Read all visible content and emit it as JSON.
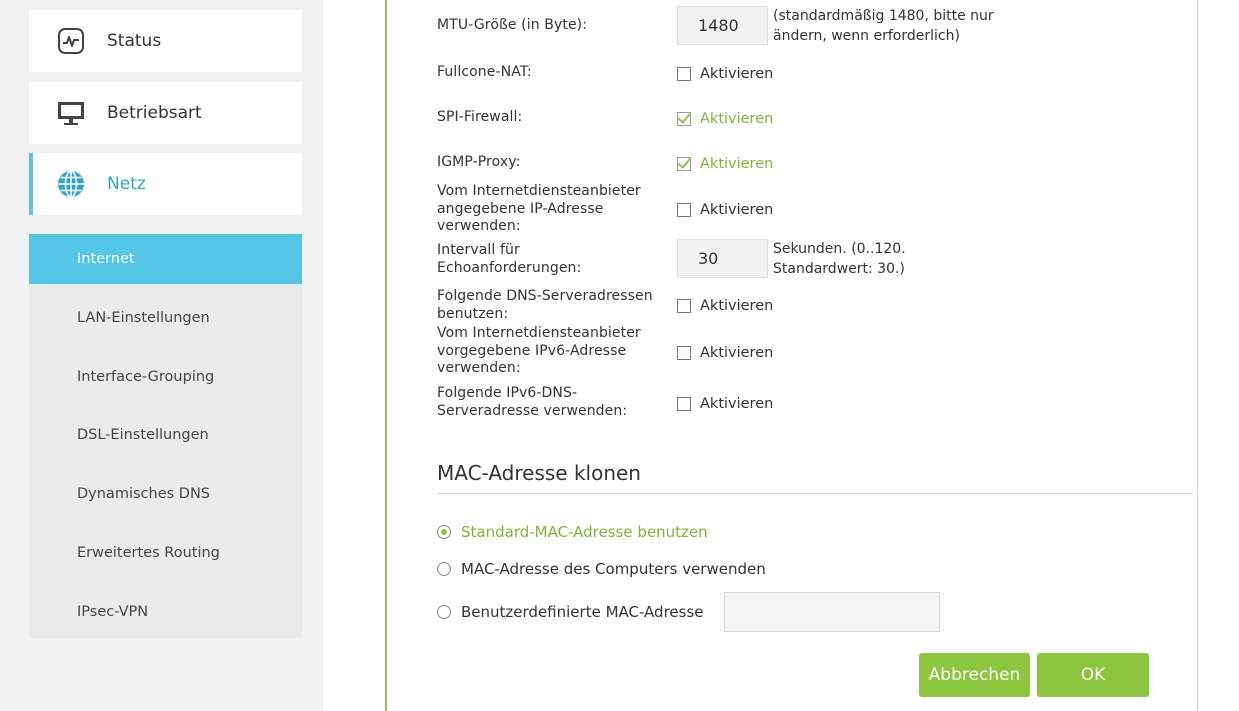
{
  "sidebar": {
    "menu": [
      {
        "label": "Status",
        "icon": "status-monitor-icon"
      },
      {
        "label": "Betriebsart",
        "icon": "monitor-icon"
      },
      {
        "label": "Netz",
        "icon": "globe-icon",
        "active": true
      }
    ],
    "submenu": [
      {
        "label": "Internet",
        "active": true
      },
      {
        "label": "LAN-Einstellungen"
      },
      {
        "label": "Interface-Grouping"
      },
      {
        "label": "DSL-Einstellungen"
      },
      {
        "label": "Dynamisches DNS"
      },
      {
        "label": "Erweitertes Routing"
      },
      {
        "label": "IPsec-VPN"
      }
    ]
  },
  "form": {
    "mtu": {
      "label": "MTU-Größe (in Byte):",
      "value": "1480",
      "hint_line1": "(standardmäßig 1480, bitte nur",
      "hint_line2": "ändern, wenn erforderlich)"
    },
    "fullcone": {
      "label": "Fullcone-NAT:",
      "option": "Aktivieren",
      "checked": false
    },
    "spi": {
      "label": "SPI-Firewall:",
      "option": "Aktivieren",
      "checked": true
    },
    "igmp": {
      "label": "IGMP-Proxy:",
      "option": "Aktivieren",
      "checked": true
    },
    "isp_ip": {
      "label_line1": "Vom Internetdiensteanbieter",
      "label_line2": "angegebene IP-Adresse",
      "label_line3": "verwenden:",
      "option": "Aktivieren",
      "checked": false
    },
    "echo": {
      "label_line1": "Intervall für",
      "label_line2": "Echoanforderungen:",
      "value": "30",
      "hint_line1": "Sekunden. (0..120.",
      "hint_line2": "Standardwert: 30.)"
    },
    "dns": {
      "label_line1": "Folgende DNS-Serveradressen",
      "label_line2": "benutzen:",
      "option": "Aktivieren",
      "checked": false
    },
    "isp_ipv6": {
      "label_line1": "Vom Internetdiensteanbieter",
      "label_line2": "vorgegebene IPv6-Adresse",
      "label_line3": "verwenden:",
      "option": "Aktivieren",
      "checked": false
    },
    "ipv6_dns": {
      "label_line1": "Folgende IPv6-DNS-",
      "label_line2": "Serveradresse verwenden:",
      "option": "Aktivieren",
      "checked": false
    }
  },
  "mac": {
    "title": "MAC-Adresse klonen",
    "options": [
      {
        "label": "Standard-MAC-Adresse benutzen",
        "checked": true
      },
      {
        "label": "MAC-Adresse des Computers verwenden",
        "checked": false
      },
      {
        "label": "Benutzerdefinierte MAC-Adresse",
        "checked": false
      }
    ],
    "custom_value": ""
  },
  "buttons": {
    "cancel": "Abbrechen",
    "ok": "OK"
  },
  "colors": {
    "accent_green": "#8cc63f",
    "accent_blue": "#54c6e6"
  }
}
